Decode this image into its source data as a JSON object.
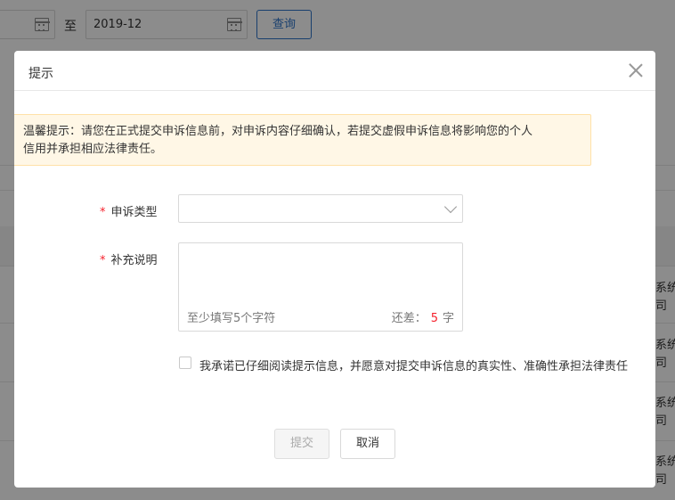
{
  "background": {
    "date_start": "",
    "separator": "至",
    "date_end": "2019-12",
    "query_button": "查询",
    "side_rows": [
      {
        "line1": "系统",
        "line2": "司（"
      },
      {
        "line1": "系统",
        "line2": "司（"
      },
      {
        "line1": "系统",
        "line2": "司（"
      },
      {
        "line1": "系统",
        "line2": "司（"
      }
    ]
  },
  "modal": {
    "title": "提示",
    "warning_line1": "温馨提示：请您在正式提交申诉信息前，对申诉内容仔细确认，若提交虚假申诉信息将影响您的个人",
    "warning_line2": "信用并承担相应法律责任。",
    "required_mark": "*",
    "type_label": "申诉类型",
    "type_value": "",
    "desc_label": "补充说明",
    "desc_placeholder": "至少填写5个字符",
    "counter_prefix": "还差：",
    "counter_value": "5",
    "counter_suffix": "字",
    "agree_text": "我承诺已仔细阅读提示信息，并愿意对提交申诉信息的真实性、准确性承担法律责任",
    "submit_button": "提交",
    "cancel_button": "取消"
  }
}
